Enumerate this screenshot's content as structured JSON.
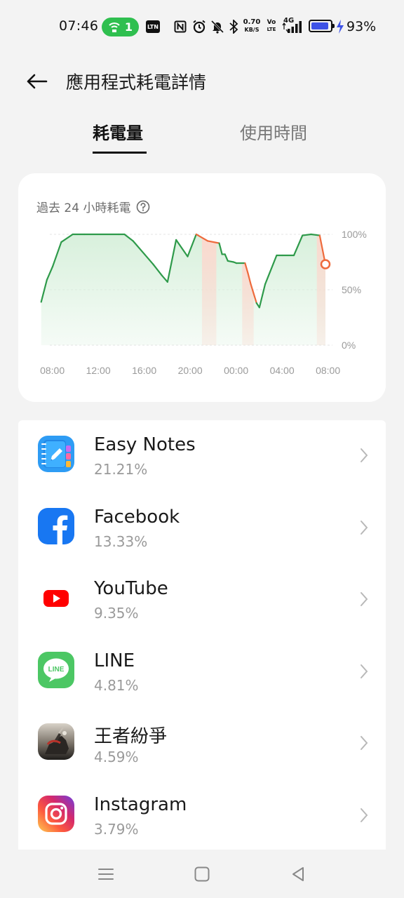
{
  "status_bar": {
    "time": "07:46",
    "hotspot_count": "1",
    "ltn_label": "LTN",
    "network_speed_value": "0.70",
    "network_speed_unit": "KB/S",
    "volte_top": "Vo",
    "volte_bottom": "LTE",
    "network_type": "4G",
    "battery_percent": "93%",
    "battery_level": 0.93
  },
  "header": {
    "title": "應用程式耗電詳情"
  },
  "tabs": [
    {
      "label": "耗電量",
      "active": true
    },
    {
      "label": "使用時間",
      "active": false
    }
  ],
  "chart_data": {
    "type": "line",
    "title": "過去 24 小時耗電",
    "x_tick_labels": [
      "08:00",
      "12:00",
      "16:00",
      "20:00",
      "00:00",
      "04:00",
      "08:00"
    ],
    "y_tick_labels": [
      "100%",
      "50%",
      "0%"
    ],
    "ylim": [
      0,
      100
    ],
    "xlim_hours": [
      0,
      24
    ],
    "series": [
      {
        "x": [
          -0.75,
          -0.25,
          0.25,
          1,
          2,
          3,
          6,
          6.5,
          7.25,
          8.25,
          9,
          9.75,
          10.25,
          11,
          12,
          12.75,
          13.75,
          14.75,
          15,
          15.25,
          15.5,
          16,
          16.25,
          17,
          17.25,
          17.5,
          18,
          18.25,
          18.75,
          19.75,
          20.25,
          21.25,
          22,
          22.75,
          23.5,
          24
        ],
        "y": [
          39,
          59,
          71,
          93,
          100,
          100,
          100,
          100,
          94,
          82,
          73,
          63,
          57,
          95,
          80,
          100,
          94,
          92,
          82,
          82,
          76,
          75,
          74,
          74,
          65,
          55,
          38,
          34,
          55,
          81,
          81,
          81,
          99,
          100,
          99,
          73
        ]
      }
    ],
    "charging_x_ranges": [
      [
        13.25,
        14.5
      ],
      [
        16.75,
        17.75
      ],
      [
        23.25,
        24
      ]
    ],
    "colors": {
      "line": "#2e9a4a",
      "charging_line": "#ee6a3c",
      "fill": "#d8f0dc",
      "charging_fill": "#fbd9cf"
    },
    "grid": true
  },
  "apps": [
    {
      "name": "Easy Notes",
      "percent": "21.21%",
      "icon": "easy-notes-icon"
    },
    {
      "name": "Facebook",
      "percent": "13.33%",
      "icon": "facebook-icon"
    },
    {
      "name": "YouTube",
      "percent": "9.35%",
      "icon": "youtube-icon"
    },
    {
      "name": "LINE",
      "percent": "4.81%",
      "icon": "line-icon",
      "icon_text": "LINE"
    },
    {
      "name": "王者紛爭",
      "percent": "4.59%",
      "icon": "game-icon"
    },
    {
      "name": "Instagram",
      "percent": "3.79%",
      "icon": "instagram-icon"
    }
  ]
}
